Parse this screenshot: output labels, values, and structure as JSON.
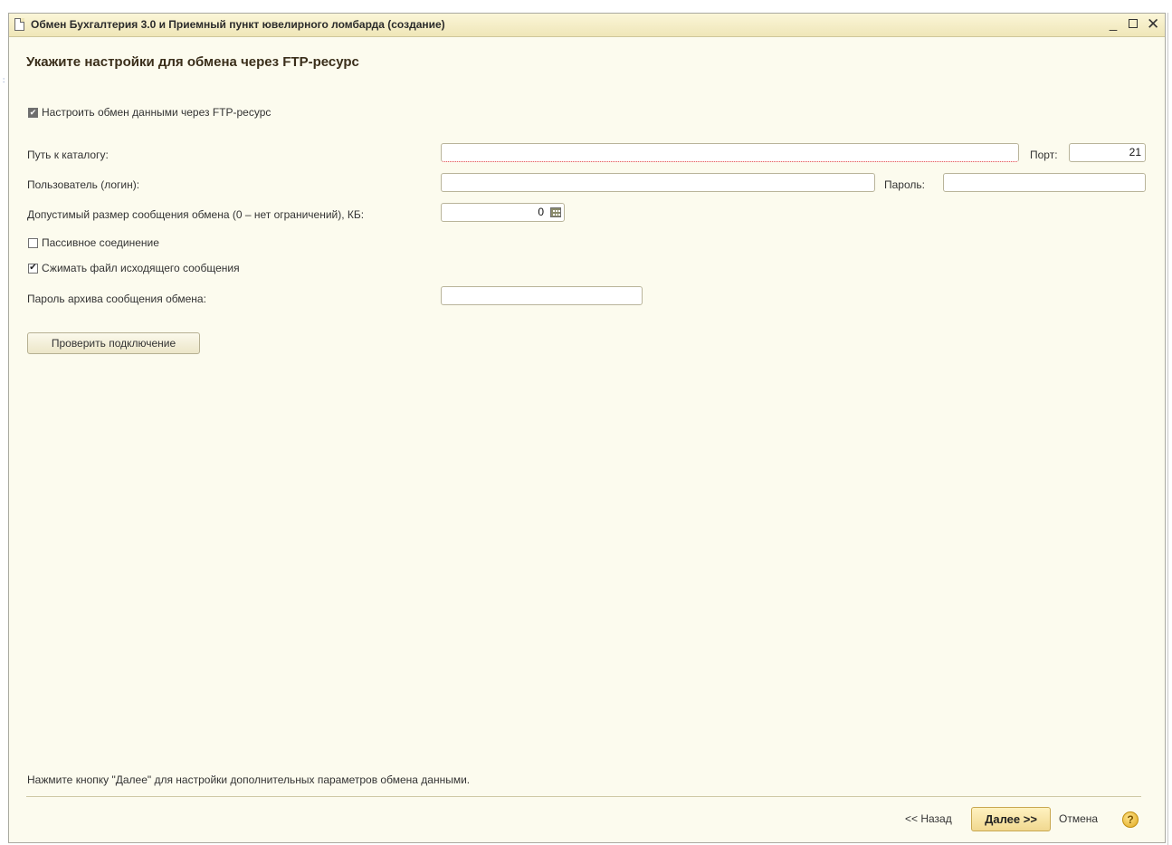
{
  "window": {
    "title": "Обмен Бухгалтерия 3.0 и Приемный пункт ювелирного ломбарда (создание)",
    "controls": {
      "minimize": "_",
      "close": "✕"
    }
  },
  "heading": "Укажите настройки для обмена через FTP-ресурс",
  "ftp_checkbox": {
    "label": "Настроить обмен данными через FTP-ресурс",
    "checked": true
  },
  "fields": {
    "path_label": "Путь к каталогу:",
    "path_value": "",
    "port_label": "Порт:",
    "port_value": "21",
    "user_label": "Пользователь (логин):",
    "user_value": "",
    "password_label": "Пароль:",
    "password_value": "",
    "max_size_label": "Допустимый размер сообщения обмена (0 – нет ограничений), КБ:",
    "max_size_value": "0",
    "archive_password_label": "Пароль архива сообщения обмена:",
    "archive_password_value": ""
  },
  "passive": {
    "label": "Пассивное соединение",
    "checked": false
  },
  "compress": {
    "label": "Сжимать файл исходящего сообщения",
    "checked": true
  },
  "check_button": "Проверить подключение",
  "footer": {
    "hint": "Нажмите кнопку \"Далее\" для настройки дополнительных параметров обмена данными.",
    "back": "<< Назад",
    "next": "Далее >>",
    "cancel": "Отмена",
    "help": "?"
  },
  "colors": {
    "window_bg": "#fcfbee",
    "titlebar": "#efe6b8",
    "primary_button": "#f1d890"
  },
  "icons": [
    "document-icon",
    "calculator-icon",
    "help-icon",
    "checkbox-checked-icon"
  ]
}
